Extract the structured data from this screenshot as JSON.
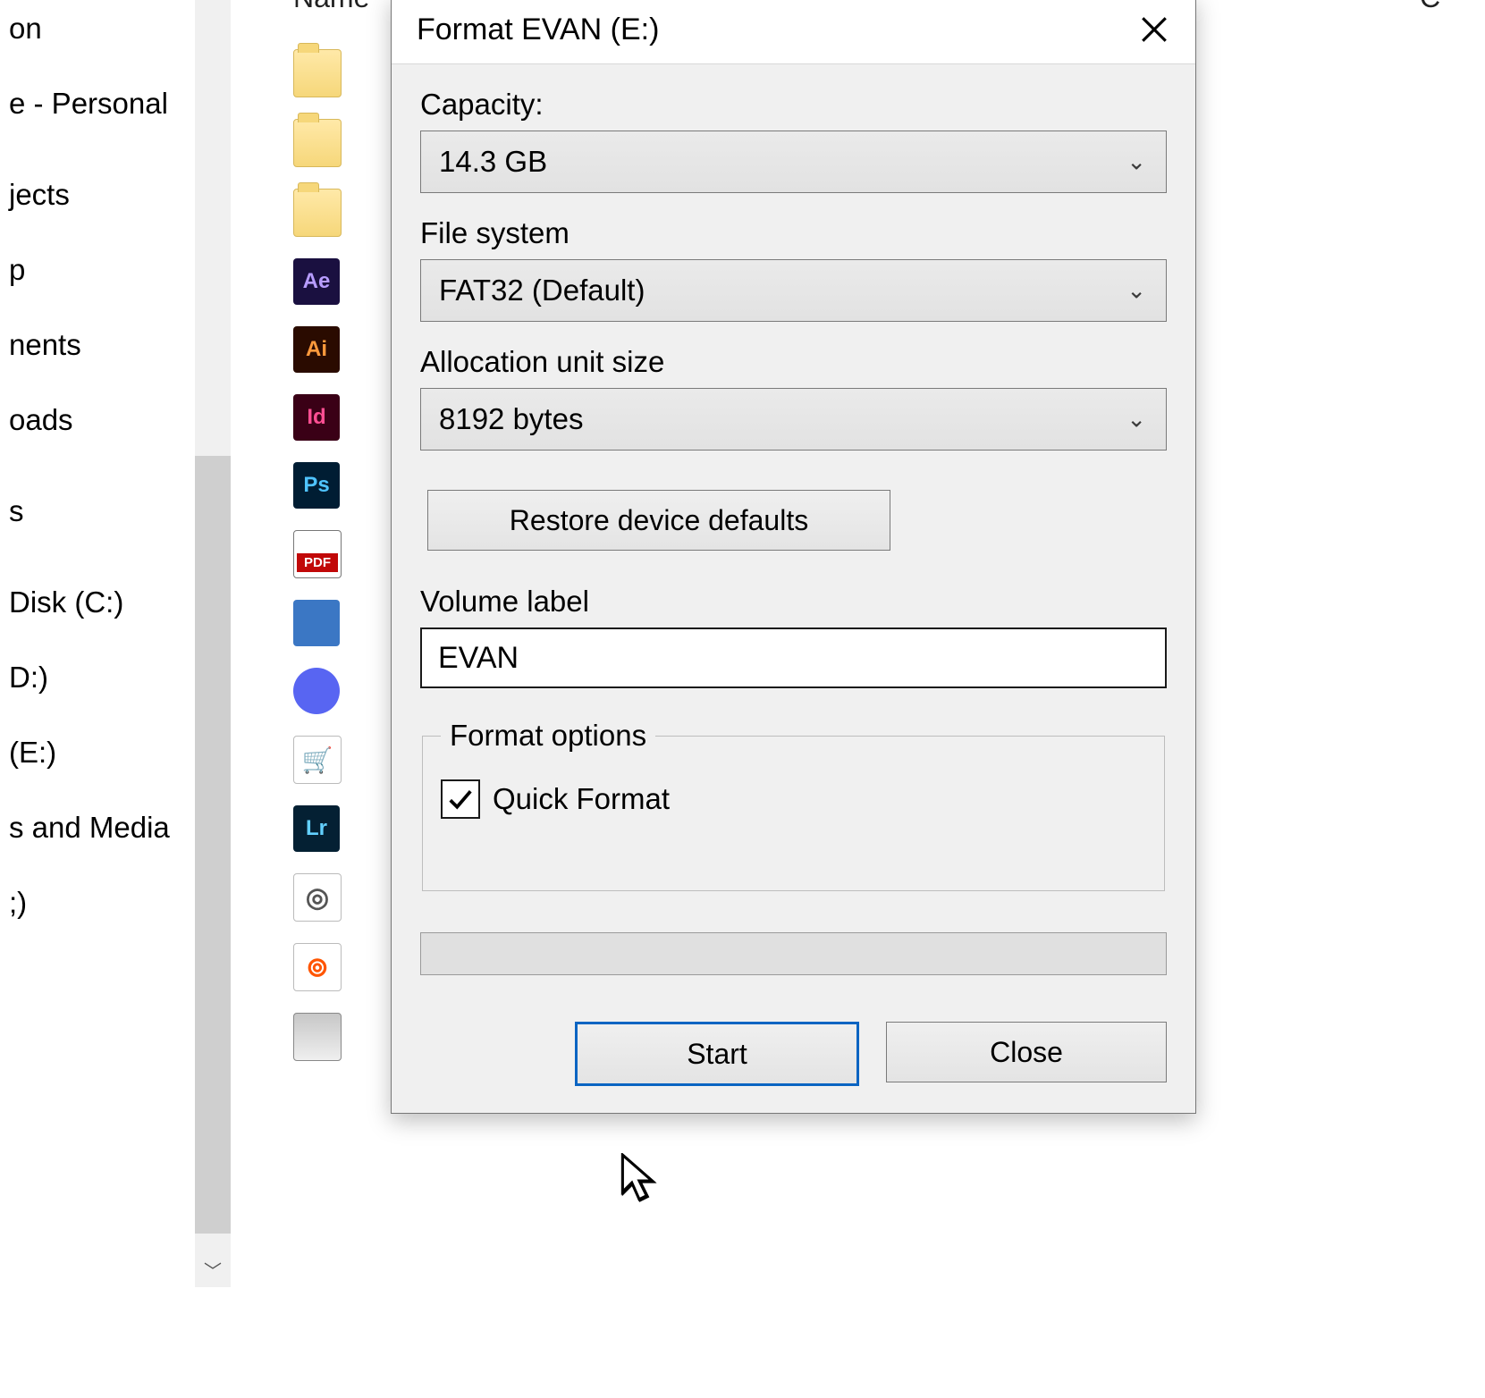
{
  "nav": {
    "items": [
      "on",
      "e - Personal",
      "jects",
      "p",
      "nents",
      "oads",
      "s",
      "Disk (C:)",
      "D:)",
      "(E:)",
      "s and Media",
      ";)"
    ]
  },
  "columns": {
    "name": "Name",
    "contact": "C"
  },
  "file_icons": [
    {
      "kind": "folder",
      "name": "folder-icon"
    },
    {
      "kind": "folder",
      "name": "folder-icon"
    },
    {
      "kind": "folder",
      "name": "folder-icon"
    },
    {
      "kind": "ae",
      "name": "after-effects-icon"
    },
    {
      "kind": "ai",
      "name": "illustrator-icon"
    },
    {
      "kind": "id",
      "name": "indesign-icon"
    },
    {
      "kind": "ps",
      "name": "photoshop-icon"
    },
    {
      "kind": "pdf",
      "name": "pdf-icon"
    },
    {
      "kind": "app-generic",
      "name": "app-shortcut-icon"
    },
    {
      "kind": "discord",
      "name": "discord-icon"
    },
    {
      "kind": "cart",
      "name": "shopping-app-icon"
    },
    {
      "kind": "lr",
      "name": "lightroom-icon"
    },
    {
      "kind": "origin",
      "name": "origin-icon"
    },
    {
      "kind": "brave",
      "name": "browser-icon"
    },
    {
      "kind": "drive",
      "name": "drive-icon"
    }
  ],
  "dialog": {
    "title": "Format EVAN (E:)",
    "capacity_label": "Capacity:",
    "capacity_value": "14.3 GB",
    "filesystem_label": "File system",
    "filesystem_value": "FAT32 (Default)",
    "alloc_label": "Allocation unit size",
    "alloc_value": "8192 bytes",
    "restore_label": "Restore device defaults",
    "volume_label_label": "Volume label",
    "volume_label_value": "EVAN",
    "format_options_legend": "Format options",
    "quick_format_label": "Quick Format",
    "quick_format_checked": true,
    "start_label": "Start",
    "close_label": "Close"
  }
}
